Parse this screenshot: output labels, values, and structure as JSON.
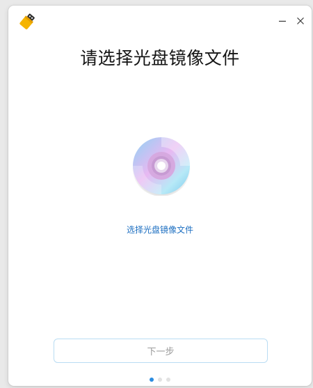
{
  "window": {
    "title": "请选择光盘镜像文件",
    "app_icon": "usb-drive-icon",
    "controls": {
      "minimize": "minimize-icon",
      "close": "close-icon"
    }
  },
  "content": {
    "disc_icon": "optical-disc-icon",
    "choose_link": "选择光盘镜像文件",
    "next_button": "下一步"
  },
  "pager": {
    "steps": 3,
    "active_step": 1
  },
  "colors": {
    "accent": "#2b8ce0",
    "link": "#1d6fc1",
    "button_border": "#b9dcf3",
    "disabled_text": "#9a9a9a"
  }
}
